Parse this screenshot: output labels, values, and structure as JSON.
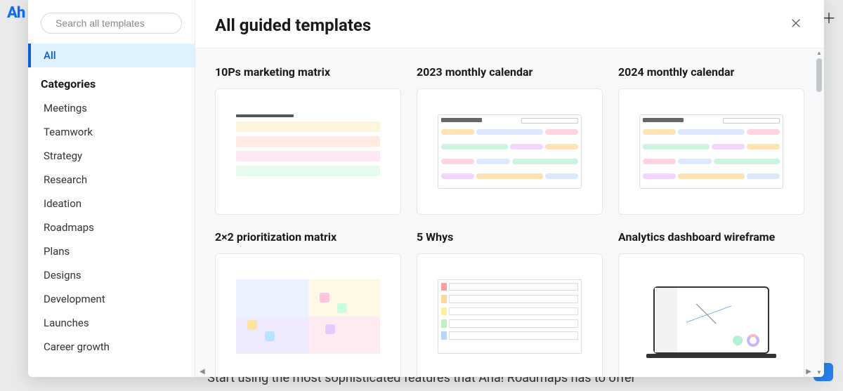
{
  "bg": {
    "logo_text": "Ah",
    "bottom_text": "Start using the most sophisticated features that Aha! Roadmaps has to offer"
  },
  "search": {
    "placeholder": "Search all templates"
  },
  "sidebar": {
    "all_label": "All",
    "categories_heading": "Categories",
    "categories": [
      "Meetings",
      "Teamwork",
      "Strategy",
      "Research",
      "Ideation",
      "Roadmaps",
      "Plans",
      "Designs",
      "Development",
      "Launches",
      "Career growth"
    ]
  },
  "main": {
    "title": "All guided templates"
  },
  "templates": [
    {
      "title": "10Ps marketing matrix",
      "preview": "matrix"
    },
    {
      "title": "2023 monthly calendar",
      "preview": "calendar"
    },
    {
      "title": "2024 monthly calendar",
      "preview": "calendar"
    },
    {
      "title": "2×2 prioritization matrix",
      "preview": "quad"
    },
    {
      "title": "5 Whys",
      "preview": "whys"
    },
    {
      "title": "Analytics dashboard wireframe",
      "preview": "analytics"
    }
  ]
}
